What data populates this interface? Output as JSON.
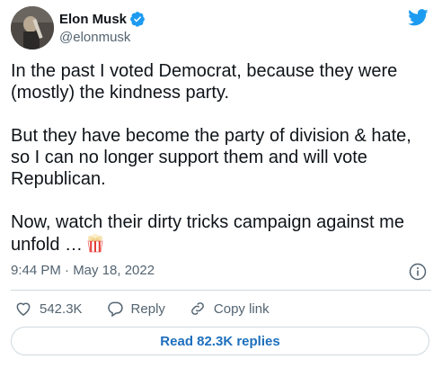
{
  "author": {
    "name": "Elon Musk",
    "handle": "@elonmusk",
    "verified_icon": "verified-badge-icon"
  },
  "platform_icon": "twitter-bird-icon",
  "tweet": {
    "paragraphs": [
      "In the past I voted Democrat, because they were (mostly) the kindness party.",
      "But they have become the party of division & hate, so I can no longer support them and will vote Republican.",
      "Now, watch their dirty tricks campaign against me unfold …"
    ],
    "emoji": "popcorn-icon",
    "timestamp": "9:44 PM · May 18, 2022"
  },
  "actions": {
    "likes": "542.3K",
    "reply_label": "Reply",
    "copy_label": "Copy link"
  },
  "read_replies_label": "Read 82.3K replies",
  "colors": {
    "text": "#0f1419",
    "secondary": "#536471",
    "brand_blue": "#1d9bf0",
    "link_blue": "#1d6fbd",
    "border": "#cfd9de"
  }
}
